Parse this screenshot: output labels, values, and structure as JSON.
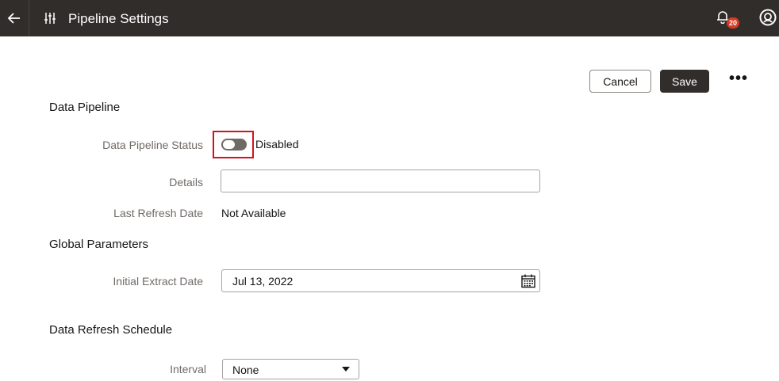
{
  "header": {
    "title": "Pipeline Settings",
    "notification_count": "20",
    "back_icon": "arrow-left-icon",
    "settings_icon": "sliders-icon",
    "bell_icon": "bell-icon",
    "avatar_icon": "user-avatar-icon"
  },
  "actions": {
    "cancel_label": "Cancel",
    "save_label": "Save",
    "more_label": "•••"
  },
  "data_pipeline": {
    "title": "Data Pipeline",
    "status_label": "Data Pipeline Status",
    "status_value": "Disabled",
    "status_enabled": false,
    "details_label": "Details",
    "details_value": "",
    "last_refresh_label": "Last Refresh Date",
    "last_refresh_value": "Not Available"
  },
  "global_parameters": {
    "title": "Global Parameters",
    "initial_extract_label": "Initial Extract Date",
    "initial_extract_value": "Jul 13, 2022"
  },
  "data_refresh_schedule": {
    "title": "Data Refresh Schedule",
    "interval_label": "Interval",
    "interval_value": "None"
  },
  "colors": {
    "header_bg": "#312d2a",
    "primary_button": "#312d2a",
    "highlight_border": "#d1131f",
    "badge": "#d63b25"
  }
}
